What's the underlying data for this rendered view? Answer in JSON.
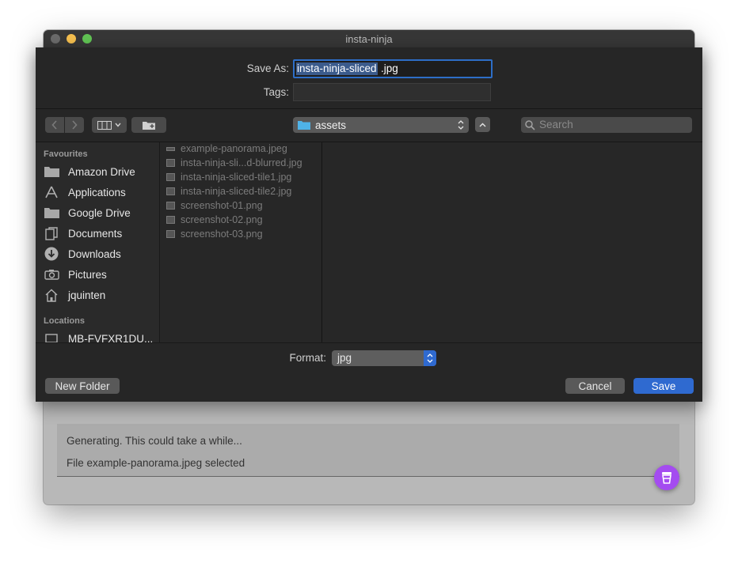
{
  "app": {
    "title": "insta-ninja",
    "status_lines": [
      "Generating. This could take a while...",
      "File example-panorama.jpeg selected"
    ]
  },
  "dialog": {
    "save_as_label": "Save As:",
    "save_as_selected": "insta-ninja-sliced",
    "save_as_rest": ".jpg",
    "tags_label": "Tags:",
    "tags_value": "",
    "location": "assets",
    "search_placeholder": "Search",
    "sidebar": {
      "favourites_heading": "Favourites",
      "favourites": [
        {
          "label": "Amazon Drive",
          "icon": "folder-icon"
        },
        {
          "label": "Applications",
          "icon": "applications-icon"
        },
        {
          "label": "Google Drive",
          "icon": "folder-icon"
        },
        {
          "label": "Documents",
          "icon": "documents-icon"
        },
        {
          "label": "Downloads",
          "icon": "downloads-icon"
        },
        {
          "label": "Pictures",
          "icon": "camera-icon"
        },
        {
          "label": "jquinten",
          "icon": "home-icon"
        }
      ],
      "locations_heading": "Locations",
      "locations": [
        {
          "label": "MB-FVFXR1DU...",
          "icon": "computer-icon"
        }
      ]
    },
    "files": [
      "example-panorama.jpeg",
      "insta-ninja-sli...d-blurred.jpg",
      "insta-ninja-sliced-tile1.jpg",
      "insta-ninja-sliced-tile2.jpg",
      "screenshot-01.png",
      "screenshot-02.png",
      "screenshot-03.png"
    ],
    "format_label": "Format:",
    "format_value": "jpg",
    "new_folder_label": "New Folder",
    "cancel_label": "Cancel",
    "save_label": "Save"
  },
  "colors": {
    "accent": "#2f6ad0",
    "fab": "#a44cf0",
    "sheet_bg": "#262626"
  }
}
